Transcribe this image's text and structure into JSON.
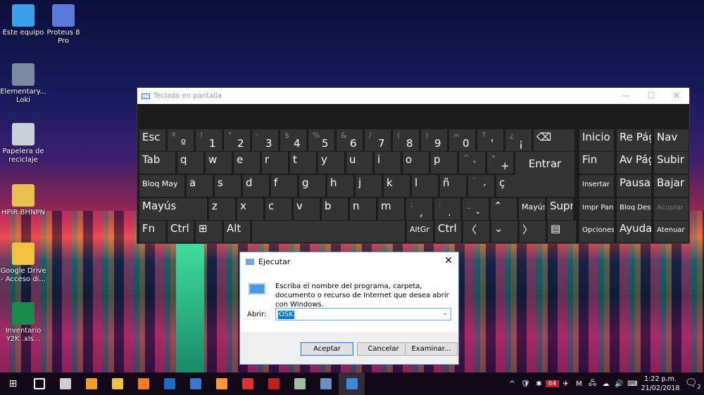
{
  "desktop": {
    "icons": [
      {
        "label": "Este equipo",
        "color": "#3aa0e8"
      },
      {
        "label": "Proteus 8 Pro",
        "color": "#5a7ad8"
      },
      {
        "label": "Elementary... Loki",
        "color": "#7a8aa0"
      },
      {
        "label": "Papelera de reciclaje",
        "color": "#c8d0d8"
      },
      {
        "label": "HPIR BHNPN",
        "color": "#e8c050"
      },
      {
        "label": "Google Drive - Acceso di...",
        "color": "#f0c040"
      },
      {
        "label": "Inventario Y2K .xls...",
        "color": "#1e8a4a"
      }
    ]
  },
  "osk": {
    "title": "Teclado en pantalla",
    "controls": [
      "—",
      "☐",
      "✕"
    ],
    "rows": [
      [
        {
          "m": "Esc"
        },
        {
          "s": "ª",
          "m": "º"
        },
        {
          "s": "!",
          "m": "1"
        },
        {
          "s": "\"",
          "m": "2"
        },
        {
          "s": "·",
          "m": "3"
        },
        {
          "s": "$",
          "m": "4"
        },
        {
          "s": "%",
          "m": "5"
        },
        {
          "s": "&",
          "m": "6"
        },
        {
          "s": "/",
          "m": "7"
        },
        {
          "s": "(",
          "m": "8"
        },
        {
          "s": ")",
          "m": "9"
        },
        {
          "s": "=",
          "m": "0"
        },
        {
          "s": "?",
          "m": "'"
        },
        {
          "s": "¿",
          "m": "¡"
        },
        {
          "m": "⌫"
        }
      ],
      [
        {
          "m": "Tab"
        },
        {
          "m": "q"
        },
        {
          "m": "w"
        },
        {
          "m": "e"
        },
        {
          "m": "r"
        },
        {
          "m": "t"
        },
        {
          "m": "y"
        },
        {
          "m": "u"
        },
        {
          "m": "i"
        },
        {
          "m": "o"
        },
        {
          "m": "p"
        },
        {
          "s": "^",
          "m": "`"
        },
        {
          "s": "*",
          "m": "+"
        },
        {
          "m": "Entrar"
        }
      ],
      [
        {
          "m": "Bloq May"
        },
        {
          "m": "a"
        },
        {
          "m": "s"
        },
        {
          "m": "d"
        },
        {
          "m": "f"
        },
        {
          "m": "g"
        },
        {
          "m": "h"
        },
        {
          "m": "j"
        },
        {
          "m": "k"
        },
        {
          "m": "l"
        },
        {
          "m": "ñ"
        },
        {
          "s": "¨",
          "m": "´"
        },
        {
          "m": "ç"
        },
        {
          "m": ""
        }
      ],
      [
        {
          "m": "Mayús"
        },
        {
          "m": "z"
        },
        {
          "m": "x"
        },
        {
          "m": "c"
        },
        {
          "m": "v"
        },
        {
          "m": "b"
        },
        {
          "m": "n"
        },
        {
          "m": "m"
        },
        {
          "s": ";",
          "m": ","
        },
        {
          "s": ":",
          "m": "."
        },
        {
          "s": "_",
          "m": "-"
        },
        {
          "m": "⌃"
        },
        {
          "m": "Mayús"
        },
        {
          "m": "Supr"
        }
      ],
      [
        {
          "m": "Fn"
        },
        {
          "m": "Ctrl"
        },
        {
          "m": "⊞"
        },
        {
          "m": "Alt"
        },
        {
          "m": ""
        },
        {
          "m": "AltGr"
        },
        {
          "m": "Ctrl"
        },
        {
          "m": "〈"
        },
        {
          "m": "⌄"
        },
        {
          "m": "〉"
        },
        {
          "m": "▤"
        }
      ]
    ],
    "nav": [
      [
        "Inicio",
        "Re Pág",
        "Nav"
      ],
      [
        "Fin",
        "Av Pág",
        "Subir"
      ],
      [
        "Insertar",
        "Pausa",
        "Bajar"
      ],
      [
        "Impr Pant",
        "Bloq Despl",
        "Acoplar"
      ],
      [
        "Opciones",
        "Ayuda",
        "Atenuar"
      ]
    ]
  },
  "run": {
    "title": "Ejecutar",
    "description": "Escriba el nombre del programa, carpeta, documento o recurso de Internet que desea abrir con Windows.",
    "open_label": "Abrir:",
    "input_value": "OSK",
    "ok": "Aceptar",
    "cancel": "Cancelar",
    "browse": "Examinar...",
    "close": "✕"
  },
  "taskbar": {
    "apps": [
      "#ffffff",
      "#cfcfcf",
      "#f0a020",
      "#f0c040",
      "#ff7a20",
      "#1a6ac8",
      "#3a78d0",
      "#ff9a30",
      "#e03030",
      "#c02020",
      "#a0c0a0",
      "#6a90c0",
      "#3a8ad8"
    ],
    "tray": {
      "icons": [
        "^",
        "🛡",
        "✱",
        "64",
        "✈",
        "M",
        "🖧",
        "☁",
        "🔊",
        "⌨"
      ],
      "time": "1:22 p.m.",
      "date": "21/02/2018",
      "notifications": "2"
    }
  }
}
